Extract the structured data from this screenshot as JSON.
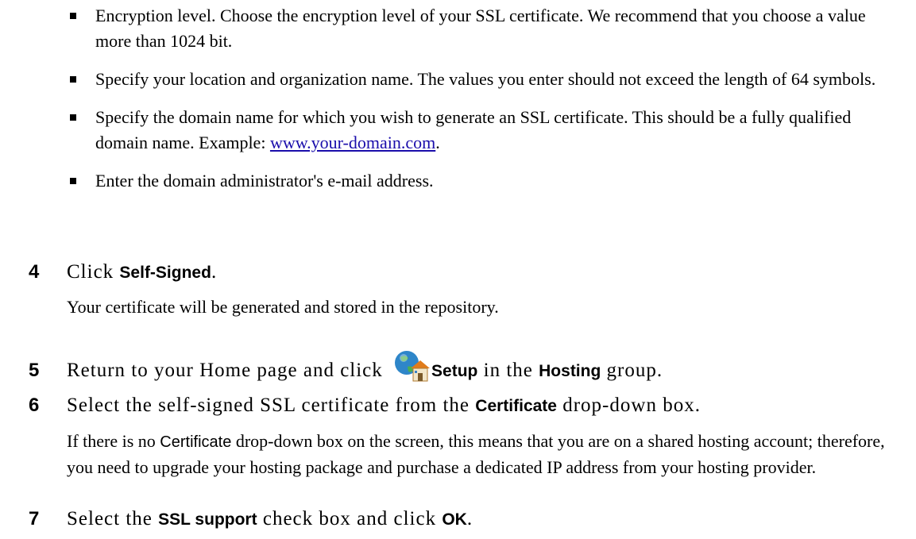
{
  "bullets": [
    {
      "text": "Encryption level. Choose the encryption level of your SSL certificate. We recommend that you choose a value more than 1024 bit."
    },
    {
      "text": "Specify your location and organization name. The values you enter should not exceed the length of 64 symbols."
    },
    {
      "text_before": "Specify the domain name for which you wish to generate an SSL certificate. This should be a fully qualified domain name. Example: ",
      "link": "www.your-domain.com",
      "text_after": "."
    },
    {
      "text": "Enter the domain administrator's e-mail address."
    }
  ],
  "step4": {
    "num": "4",
    "prefix": "Click ",
    "ui": "Self-Signed",
    "suffix": "."
  },
  "step4_note": "Your certificate will be generated and stored in the repository.",
  "step5": {
    "num": "5",
    "prefix": "Return to your Home page and click ",
    "ui1": "Setup",
    "mid": " in the ",
    "ui2": "Hosting",
    "suffix": " group.",
    "icon": "setup-globe-house-icon"
  },
  "step6": {
    "num": "6",
    "prefix": "Select the self-signed SSL certificate from the ",
    "ui": "Certificate",
    "suffix": " drop-down box."
  },
  "step6_note": {
    "prefix": "If there is no ",
    "ui": "Certificate",
    "suffix": " drop-down box on the screen, this means that you are on a shared hosting account; therefore, you need to upgrade your hosting package and purchase a dedicated IP address from your hosting provider."
  },
  "step7": {
    "num": "7",
    "prefix": "Select the ",
    "ui1": "SSL support",
    "mid": " check box and click ",
    "ui2": "OK",
    "suffix": "."
  }
}
